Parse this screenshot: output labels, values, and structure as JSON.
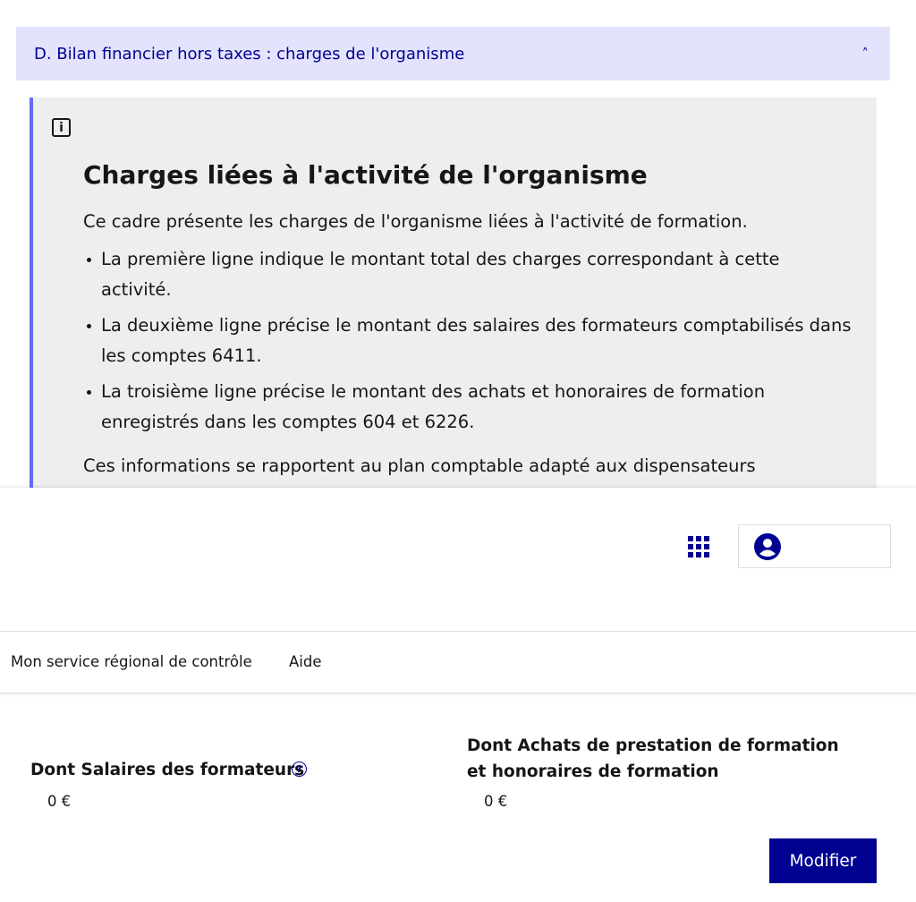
{
  "accordion": {
    "title": "D. Bilan financier hors taxes : charges de l'organisme",
    "chevron": "˄"
  },
  "callout": {
    "info_icon": "i",
    "title": "Charges liées à l'activité de l'organisme",
    "intro": "Ce cadre présente les charges de l'organisme liées à l'activité de formation.",
    "items": [
      "La première ligne indique le montant total des charges correspondant à cette activité.",
      "La deuxième ligne précise le montant des salaires des formateurs comptabilisés dans les comptes 6411.",
      "La troisième ligne précise le montant des achats et honoraires de formation enregistrés dans les comptes 604 et 6226."
    ],
    "note": "Ces informations se rapportent au plan comptable adapté aux dispensateurs"
  },
  "header": {
    "apps_icon": "grid-icon",
    "account_icon": "account-circle-icon"
  },
  "nav": {
    "items": [
      "Mon service régional de contrôle",
      "Aide"
    ]
  },
  "fields": {
    "salaires": {
      "label": "Dont Salaires des formateurs",
      "value": "0 €",
      "help_icon": "?"
    },
    "achats": {
      "label": "Dont Achats de prestation de formation et honoraires de formation",
      "value": "0 €"
    }
  },
  "actions": {
    "modify_label": "Modifier"
  },
  "colors": {
    "accent": "#000091",
    "accordion_bg": "#e3e3fd",
    "callout_border": "#6a6af4",
    "callout_bg": "#eeeeee"
  }
}
